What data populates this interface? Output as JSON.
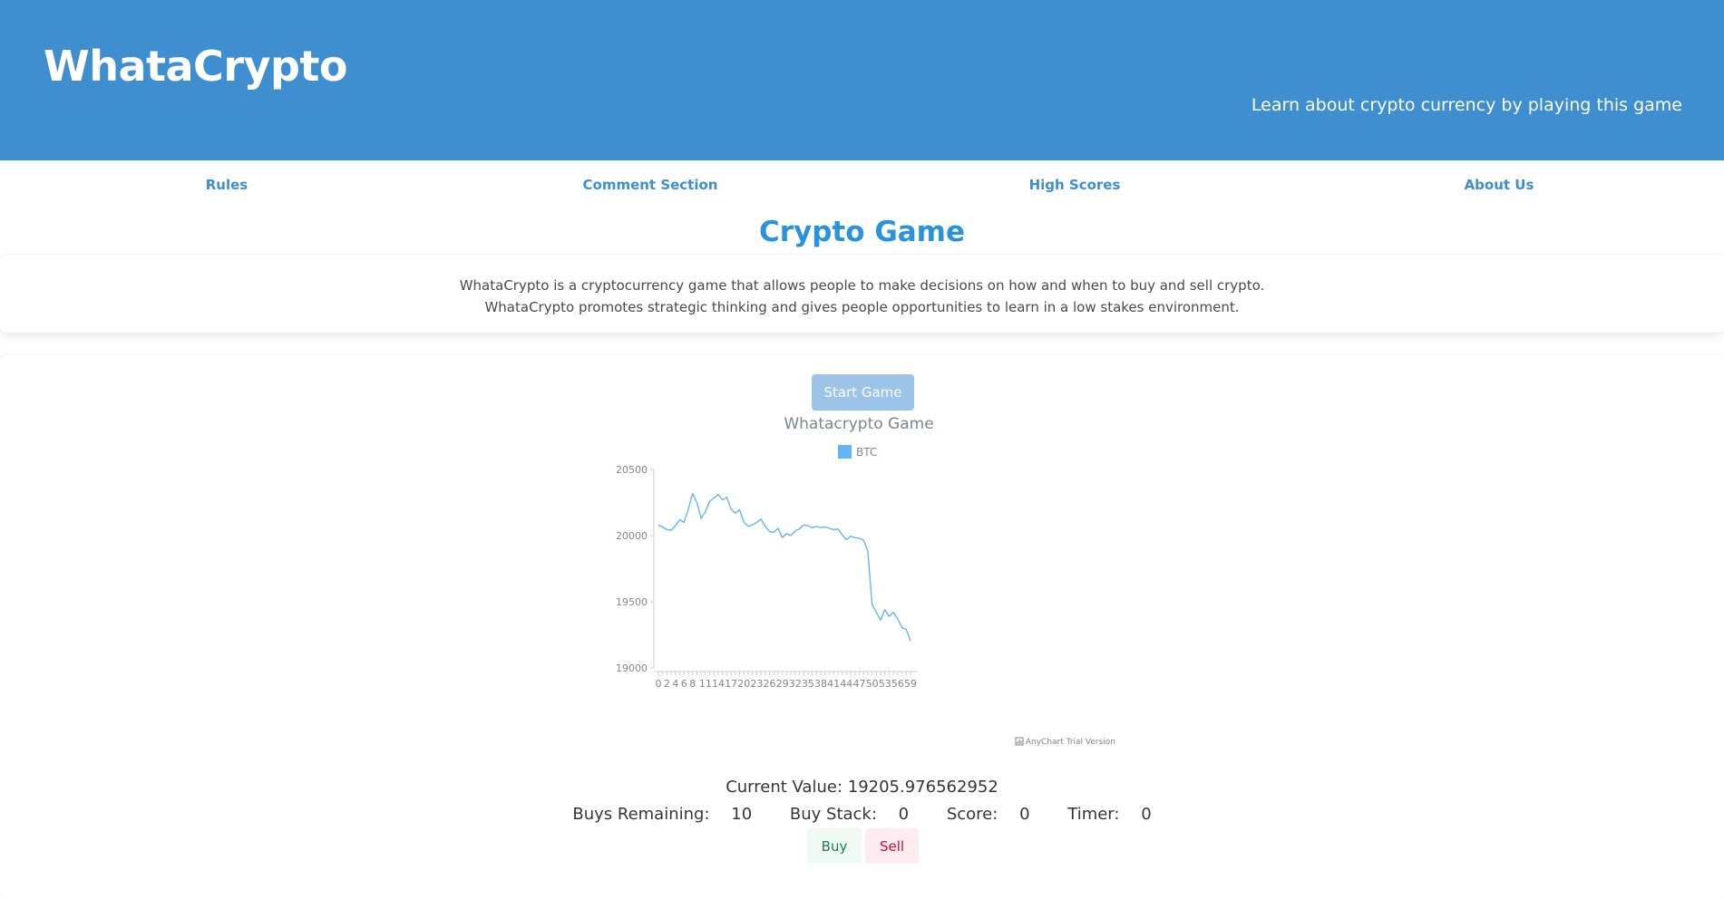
{
  "header": {
    "brand": "WhataCrypto",
    "tagline": "Learn about crypto currency by playing this game",
    "bg_color": "#3e8ed0"
  },
  "nav": {
    "items": [
      {
        "label": "Rules"
      },
      {
        "label": "Comment Section"
      },
      {
        "label": "High Scores"
      },
      {
        "label": "About Us"
      }
    ]
  },
  "page_title": "Crypto Game",
  "intro": {
    "line1": "WhataCrypto is a cryptocurrency game that allows people to make decisions on how and when to buy and sell crypto.",
    "line2": "WhataCrypto promotes strategic thinking and gives people opportunities to learn in a low stakes environment."
  },
  "game": {
    "start_label": "Start Game",
    "current_value_label": "Current Value:",
    "current_value": "19205.976562952",
    "buys_remaining_label": "Buys Remaining:",
    "buys_remaining": "10",
    "buy_stack_label": "Buy Stack:",
    "buy_stack": "0",
    "score_label": "Score:",
    "score": "0",
    "timer_label": "Timer:",
    "timer": "0",
    "buy_label": "Buy",
    "sell_label": "Sell"
  },
  "chart_credit": "AnyChart Trial Version",
  "chart_data": {
    "type": "line",
    "title": "Whatacrypto Game",
    "xlabel": "",
    "ylabel": "",
    "ylim": [
      19000,
      20500
    ],
    "yticks": [
      19000,
      19500,
      20000,
      20500
    ],
    "grid": false,
    "legend_position": "top",
    "x": [
      0,
      1,
      2,
      3,
      4,
      5,
      6,
      7,
      8,
      9,
      10,
      11,
      12,
      13,
      14,
      15,
      16,
      17,
      18,
      19,
      20,
      21,
      22,
      23,
      24,
      25,
      26,
      27,
      28,
      29,
      30,
      31,
      32,
      33,
      34,
      35,
      36,
      37,
      38,
      39,
      40,
      41,
      42,
      43,
      44,
      45,
      46,
      47,
      48,
      49,
      50,
      51,
      52,
      53,
      54,
      55,
      56,
      57,
      58,
      59
    ],
    "x_tick_labels": [
      "0",
      "2",
      "4",
      "6",
      "8",
      "11",
      "14",
      "17",
      "20",
      "23",
      "26",
      "29",
      "32",
      "35",
      "38",
      "41",
      "44",
      "47",
      "50",
      "53",
      "56",
      "59"
    ],
    "series": [
      {
        "name": "BTC",
        "color": "#64b5f6",
        "values": [
          20080,
          20065,
          20045,
          20040,
          20075,
          20120,
          20100,
          20200,
          20320,
          20250,
          20130,
          20180,
          20260,
          20285,
          20310,
          20270,
          20290,
          20200,
          20170,
          20195,
          20100,
          20070,
          20080,
          20100,
          20125,
          20070,
          20030,
          20025,
          20055,
          19985,
          20015,
          20000,
          20035,
          20050,
          20080,
          20075,
          20060,
          20070,
          20060,
          20065,
          20055,
          20045,
          20050,
          20005,
          19970,
          19995,
          19985,
          19980,
          19965,
          19885,
          19480,
          19420,
          19360,
          19440,
          19390,
          19420,
          19370,
          19305,
          19290,
          19205
        ]
      }
    ]
  }
}
